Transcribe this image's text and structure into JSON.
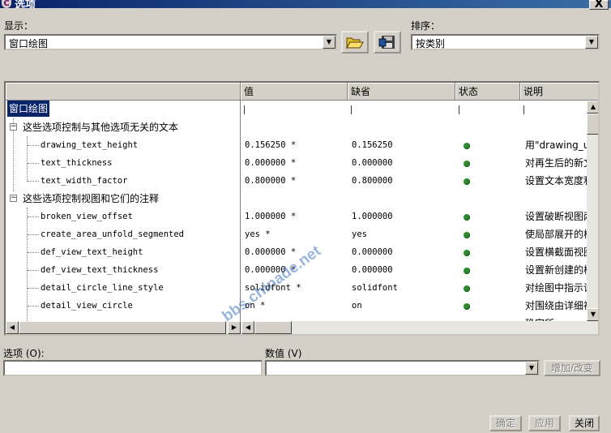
{
  "window": {
    "title": "选项",
    "close_glyph": "X"
  },
  "display": {
    "label": "显示：",
    "value": "窗口绘图"
  },
  "sort": {
    "label": "排序：",
    "value": "按类别"
  },
  "toolbar": {
    "open_icon": "folder-open-icon",
    "save_icon": "save-icon"
  },
  "columns": {
    "option": "",
    "value": "值",
    "default": "缺省",
    "status": "状态",
    "description": "说明"
  },
  "tree": {
    "root": "窗口绘图",
    "groups": [
      {
        "label": "这些选项控制与其他选项无关的文本",
        "items": [
          {
            "name": "drawing_text_height",
            "value": "0.156250 *",
            "default": "0.156250",
            "desc": "用\"drawing_un"
          },
          {
            "name": "text_thickness",
            "value": "0.000000 *",
            "default": "0.000000",
            "desc": "对再生后的新文"
          },
          {
            "name": "text_width_factor",
            "value": "0.800000 *",
            "default": "0.800000",
            "desc": "设置文本宽度和"
          }
        ]
      },
      {
        "label": "这些选项控制视图和它们的注释",
        "items": [
          {
            "name": "broken_view_offset",
            "value": "1.000000 *",
            "default": "1.000000",
            "desc": "设置破断视图两"
          },
          {
            "name": "create_area_unfold_segmented",
            "value": "yes *",
            "default": "yes",
            "desc": "使局部展开的横"
          },
          {
            "name": "def_view_text_height",
            "value": "0.000000 *",
            "default": "0.000000",
            "desc": "设置横截面视图"
          },
          {
            "name": "def_view_text_thickness",
            "value": "0.000000 *",
            "default": "0.000000",
            "desc": "设置新创建的横"
          },
          {
            "name": "detail_circle_line_style",
            "value": "solidfont *",
            "default": "solidfont",
            "desc": "对绘图中指示详"
          },
          {
            "name": "detail_view_circle",
            "value": "on *",
            "default": "on",
            "desc": "对围绕由详细视"
          }
        ]
      }
    ],
    "cut_off_desc": "确定所"
  },
  "status_color": "#2e8b32",
  "option_field": {
    "label": "选项 (O):",
    "value": ""
  },
  "value_field": {
    "label": "数值 (V)",
    "value": ""
  },
  "buttons": {
    "add_change": "增加/改变",
    "ok": "确定",
    "apply": "应用",
    "close": "关闭"
  },
  "watermark": "bbs.chinade.net"
}
